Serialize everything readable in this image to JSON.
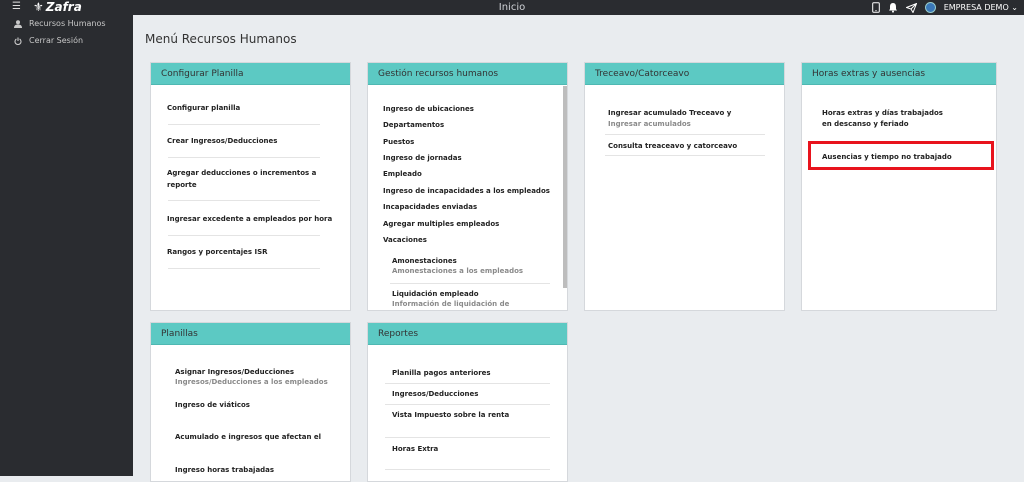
{
  "app": {
    "name": "Zafra",
    "page_title": "Inicio",
    "company": "EMPRESA DEMO"
  },
  "sidebar": {
    "items": [
      {
        "label": "Recursos Humanos"
      },
      {
        "label": "Cerrar Sesión"
      }
    ]
  },
  "main": {
    "title": "Menú Recursos Humanos"
  },
  "panels": {
    "configurar": {
      "title": "Configurar Planilla",
      "items": [
        "Configurar planilla",
        "Crear Ingresos/Deducciones",
        "Agregar deducciones o incrementos a",
        "reporte",
        "Ingresar excedente a empleados por hora",
        "Rangos y porcentajes ISR"
      ]
    },
    "gestion": {
      "title": "Gestión recursos humanos",
      "items": [
        "Ingreso de ubicaciones",
        "Departamentos",
        "Puestos",
        "Ingreso de jornadas",
        "Empleado",
        "Ingreso de incapacidades a los empleados",
        "Incapacidades enviadas",
        "Agregar multiples empleados",
        "Vacaciones",
        "Amonestaciones",
        "Amonestaciones a los empleados",
        "Liquidación empleado",
        "Información de liquidación de"
      ]
    },
    "treceavo": {
      "title": "Treceavo/Catorceavo",
      "items": [
        "Ingresar acumulado Treceavo y",
        "Ingresar acumulados",
        "Consulta treaceavo y catorceavo"
      ]
    },
    "horas": {
      "title": "Horas extras y ausencias",
      "items": [
        "Horas extras y días trabajados",
        "en descanso y feriado",
        "Ausencias y tiempo no trabajado"
      ]
    },
    "planillas": {
      "title": "Planillas",
      "items": [
        "Asignar Ingresos/Deducciones",
        "Ingresos/Deducciones a los empleados",
        "Ingreso de viáticos",
        "Acumulado e ingresos que afectan el",
        "Ingreso horas trabajadas"
      ]
    },
    "reportes": {
      "title": "Reportes",
      "items": [
        "Planilla pagos anteriores",
        "Ingresos/Deducciones",
        "Vista Impuesto sobre la renta",
        "Horas Extra"
      ]
    }
  },
  "colors": {
    "accent": "#5cc9c3",
    "highlight": "#e8131d",
    "sidebar": "#2a2c30"
  }
}
